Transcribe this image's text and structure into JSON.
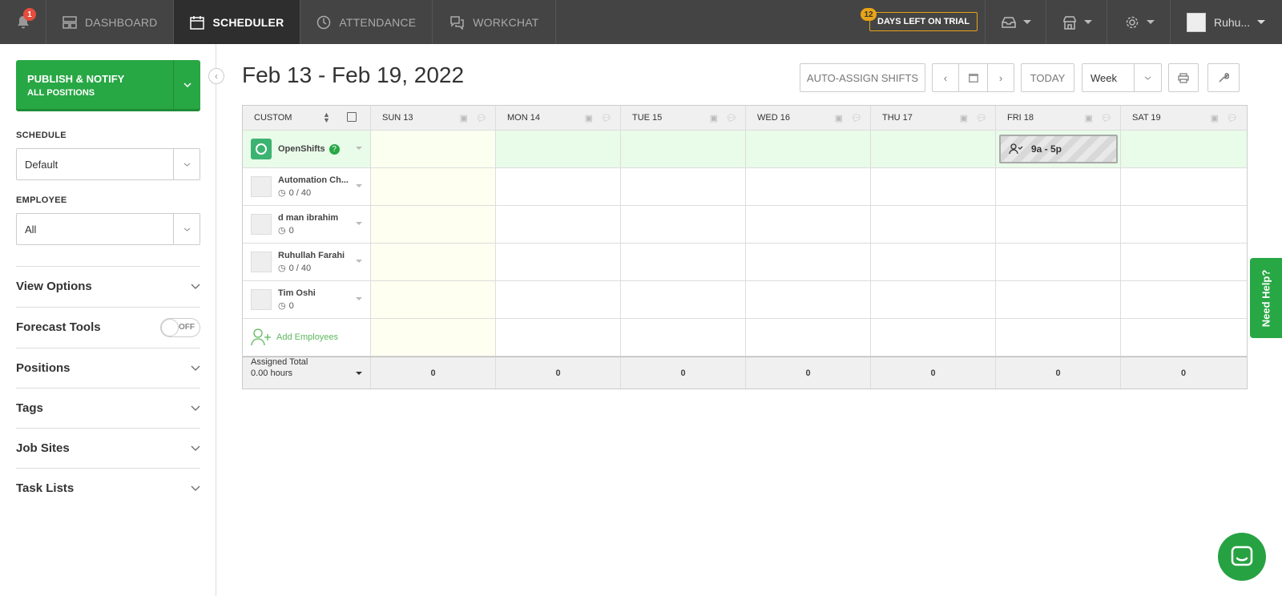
{
  "nav": {
    "notification_count": "1",
    "tabs": [
      {
        "label": "DASHBOARD",
        "icon": "dashboard-icon"
      },
      {
        "label": "SCHEDULER",
        "icon": "calendar-icon"
      },
      {
        "label": "ATTENDANCE",
        "icon": "clock-icon"
      },
      {
        "label": "WORKCHAT",
        "icon": "chat-icon"
      }
    ],
    "trial_days": "12",
    "trial_label": "DAYS LEFT ON TRIAL",
    "user_name": "Ruhu..."
  },
  "sidebar": {
    "publish_label": "PUBLISH & NOTIFY",
    "publish_sub": "ALL POSITIONS",
    "schedule_label": "SCHEDULE",
    "schedule_value": "Default",
    "employee_label": "EMPLOYEE",
    "employee_value": "All",
    "sections": [
      "View Options",
      "Forecast Tools",
      "Positions",
      "Tags",
      "Job Sites",
      "Task Lists"
    ],
    "forecast_toggle": "OFF"
  },
  "main": {
    "date_range": "Feb 13 - Feb 19, 2022",
    "auto_assign": "AUTO-ASSIGN SHIFTS",
    "today": "TODAY",
    "view": "Week"
  },
  "grid": {
    "sort_label": "CUSTOM",
    "days": [
      "SUN 13",
      "MON 14",
      "TUE 15",
      "WED 16",
      "THU 17",
      "FRI 18",
      "SAT 19"
    ],
    "open_shifts_label": "OpenShifts",
    "open_shift_time": "9a - 5p",
    "employees": [
      {
        "name": "Automation Ch...",
        "hours": "0 / 40"
      },
      {
        "name": "d man ibrahim",
        "hours": "0"
      },
      {
        "name": "Ruhullah Farahi",
        "hours": "0 / 40"
      },
      {
        "name": "Tim Oshi",
        "hours": "0"
      }
    ],
    "add_employees": "Add Employees",
    "total_label": "Assigned Total",
    "total_hours": "0.00 hours",
    "totals": [
      "0",
      "0",
      "0",
      "0",
      "0",
      "0",
      "0"
    ]
  },
  "help_label": "Need Help?",
  "colors": {
    "accent": "#28a745",
    "topbar": "#444444",
    "trial": "#e8a317"
  }
}
